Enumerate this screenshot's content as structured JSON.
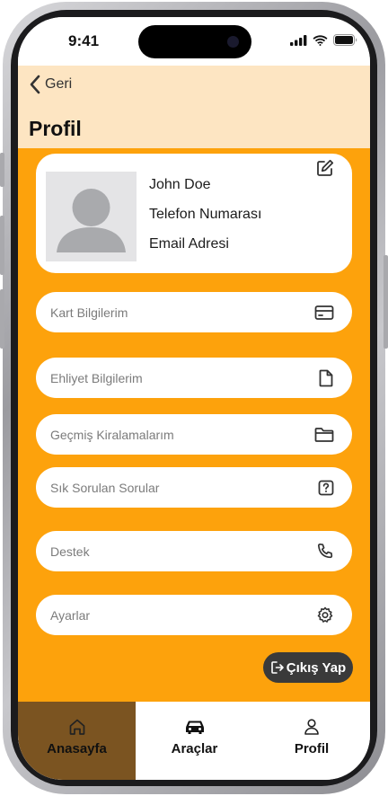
{
  "status_bar": {
    "time": "9:41"
  },
  "header": {
    "back_label": "Geri",
    "title": "Profil"
  },
  "profile": {
    "name": "John Doe",
    "phone": "Telefon Numarası",
    "email": "Email Adresi"
  },
  "menu": {
    "items": [
      {
        "label": "Kart Bilgilerim",
        "icon": "credit-card-icon"
      },
      {
        "label": "Ehliyet Bilgilerim",
        "icon": "document-icon"
      },
      {
        "label": "Geçmiş Kiralamalarım",
        "icon": "folder-icon"
      },
      {
        "label": "Sık Sorulan Sorular",
        "icon": "question-icon"
      },
      {
        "label": "Destek",
        "icon": "phone-icon"
      },
      {
        "label": "Ayarlar",
        "icon": "gear-icon"
      }
    ]
  },
  "logout": {
    "label": "Çıkış Yap",
    "icon": "logout-icon"
  },
  "tabbar": {
    "tabs": [
      {
        "label": "Anasayfa",
        "icon": "home-icon",
        "selected": true
      },
      {
        "label": "Araçlar",
        "icon": "car-icon",
        "selected": false
      },
      {
        "label": "Profil",
        "icon": "user-icon",
        "selected": false
      }
    ]
  },
  "colors": {
    "accent": "#fda20c",
    "header_bg": "#fde5c2",
    "selected_tab": "#7b5421",
    "logout_bg": "#3a3a3a"
  }
}
